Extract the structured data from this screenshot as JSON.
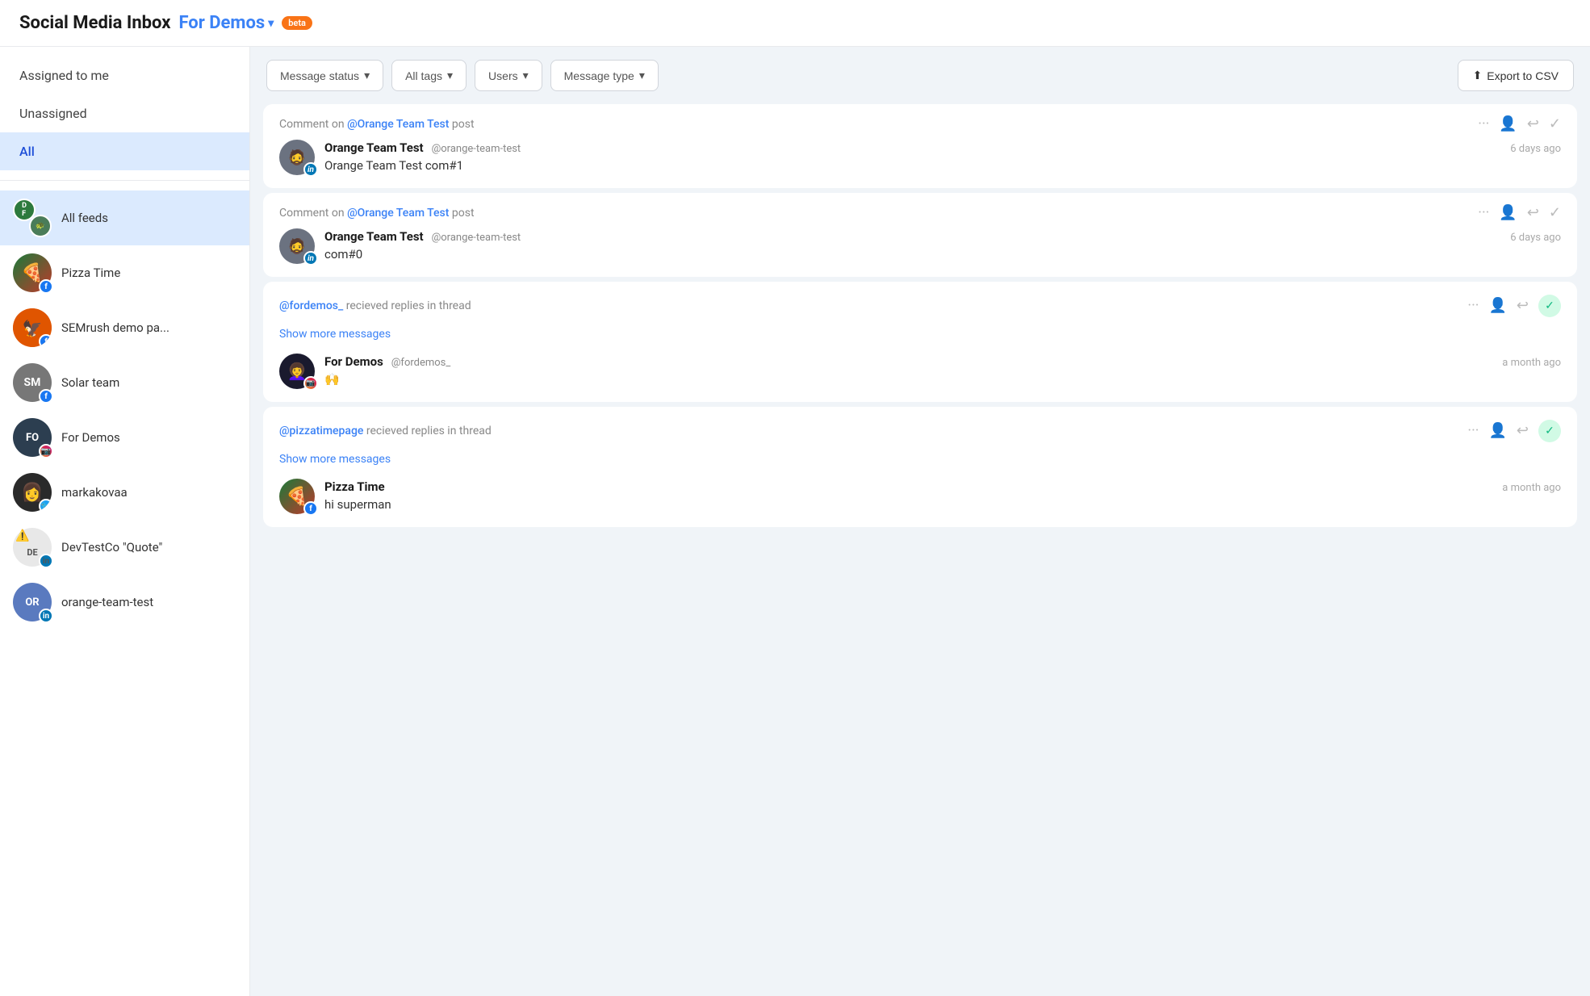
{
  "header": {
    "title": "Social Media Inbox",
    "demo_label": "For Demos",
    "beta_label": "beta"
  },
  "sidebar": {
    "nav_items": [
      {
        "id": "assigned",
        "label": "Assigned to me",
        "active": false
      },
      {
        "id": "unassigned",
        "label": "Unassigned",
        "active": false
      },
      {
        "id": "all",
        "label": "All",
        "active": true
      }
    ],
    "feeds": [
      {
        "id": "all-feeds",
        "label": "All feeds",
        "avatar_type": "multi",
        "active": true
      },
      {
        "id": "pizza-time",
        "label": "Pizza Time",
        "avatar_type": "pizza",
        "social": "facebook",
        "active": false
      },
      {
        "id": "semrush",
        "label": "SEMrush demo pa...",
        "avatar_type": "semrush",
        "social": "facebook",
        "active": false
      },
      {
        "id": "solar-team",
        "label": "Solar team",
        "avatar_type": "solar",
        "social": "facebook",
        "active": false
      },
      {
        "id": "for-demos",
        "label": "For Demos",
        "avatar_type": "fordemos",
        "avatar_text": "FO",
        "social": "instagram",
        "active": false
      },
      {
        "id": "markakovaa",
        "label": "markakovaa",
        "avatar_type": "markakovaa",
        "social": "twitter",
        "active": false
      },
      {
        "id": "devtest",
        "label": "DevTestCo \"Quote\"",
        "avatar_type": "devtest",
        "avatar_text": "DE",
        "social": "linkedin",
        "active": false
      },
      {
        "id": "orange-test",
        "label": "orange-team-test",
        "avatar_type": "orange",
        "avatar_text": "OR",
        "social": "linkedin",
        "active": false
      }
    ]
  },
  "filters": {
    "message_status": "Message status",
    "all_tags": "All tags",
    "users": "Users",
    "message_type": "Message type",
    "export_csv": "Export to CSV"
  },
  "messages": [
    {
      "id": "msg1",
      "context_prefix": "Comment on",
      "context_link": "@Orange Team Test",
      "context_suffix": "post",
      "author": "Orange Team Test",
      "handle": "@orange-team-test",
      "time": "6 days ago",
      "text": "Orange Team Test com#1",
      "social": "linkedin",
      "resolved": false,
      "show_more": false
    },
    {
      "id": "msg2",
      "context_prefix": "Comment on",
      "context_link": "@Orange Team Test",
      "context_suffix": "post",
      "author": "Orange Team Test",
      "handle": "@orange-team-test",
      "time": "6 days ago",
      "text": "com#0",
      "social": "linkedin",
      "resolved": false,
      "show_more": false
    },
    {
      "id": "msg3",
      "context_prefix": "",
      "context_link": "@fordemos_",
      "context_suffix": "recieved replies in thread",
      "author": "For Demos",
      "handle": "@fordemos_",
      "time": "a month ago",
      "text": "🙌",
      "social": "instagram",
      "resolved": true,
      "show_more": true,
      "show_more_label": "Show more messages"
    },
    {
      "id": "msg4",
      "context_prefix": "",
      "context_link": "@pizzatimepage",
      "context_suffix": "recieved replies in thread",
      "author": "Pizza Time",
      "handle": "",
      "time": "a month ago",
      "text": "hi superman",
      "social": "facebook",
      "resolved": true,
      "show_more": true,
      "show_more_label": "Show more messages"
    }
  ]
}
